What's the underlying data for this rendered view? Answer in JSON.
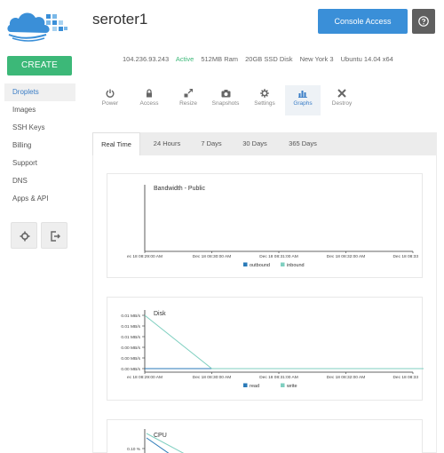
{
  "droplet": {
    "name": "seroter1",
    "ip": "104.236.93.243",
    "status": "Active",
    "ram": "512MB Ram",
    "disk": "20GB SSD Disk",
    "region": "New York 3",
    "os": "Ubuntu 14.04 x64"
  },
  "header": {
    "console_label": "Console Access"
  },
  "sidebar": {
    "create_label": "CREATE",
    "items": [
      {
        "label": "Droplets"
      },
      {
        "label": "Images"
      },
      {
        "label": "SSH Keys"
      },
      {
        "label": "Billing"
      },
      {
        "label": "Support"
      },
      {
        "label": "DNS"
      },
      {
        "label": "Apps & API"
      }
    ]
  },
  "tools": [
    {
      "label": "Power",
      "icon": "power-icon"
    },
    {
      "label": "Access",
      "icon": "lock-icon"
    },
    {
      "label": "Resize",
      "icon": "resize-icon"
    },
    {
      "label": "Snapshots",
      "icon": "camera-icon"
    },
    {
      "label": "Settings",
      "icon": "gear-icon"
    },
    {
      "label": "Graphs",
      "icon": "bar-chart-icon"
    },
    {
      "label": "Destroy",
      "icon": "close-icon"
    }
  ],
  "ranges": [
    {
      "label": "Real Time"
    },
    {
      "label": "24 Hours"
    },
    {
      "label": "7 Days"
    },
    {
      "label": "30 Days"
    },
    {
      "label": "365 Days"
    }
  ],
  "colors": {
    "accent": "#3a8fd8",
    "create": "#3cb878",
    "outbound": "#2a7ab8",
    "inbound": "#7fcfc0"
  },
  "chart_data": [
    {
      "type": "line",
      "title": "Bandwidth - Public",
      "x_ticks": [
        "ec 18 08:29:00 AM",
        "Dec 18 08:30:00 AM",
        "Dec 18 08:31:00 AM",
        "Dec 18 08:32:00 AM",
        "Dec 18 08:33"
      ],
      "series": [
        {
          "name": "outbound",
          "values": []
        },
        {
          "name": "inbound",
          "values": []
        }
      ]
    },
    {
      "type": "line",
      "title": "Disk",
      "y_ticks": [
        "0.01 MB/s",
        "0.01 MB/s",
        "0.01 MB/s",
        "0.00 MB/s",
        "0.00 MB/s",
        "0.00 MB/s"
      ],
      "x_ticks": [
        "ec 18 08:29:00 AM",
        "Dec 18 08:30:00 AM",
        "Dec 18 08:31:00 AM",
        "Dec 18 08:32:00 AM",
        "Dec 18 08:33"
      ],
      "series": [
        {
          "name": "read",
          "x": [
            0,
            4.4
          ],
          "values": [
            0.0,
            0.0
          ]
        },
        {
          "name": "write",
          "x": [
            0,
            1,
            4.4
          ],
          "values": [
            0.01,
            0.0,
            0.0
          ]
        }
      ]
    },
    {
      "type": "line",
      "title": "CPU",
      "y_ticks": [
        "0.10 %"
      ],
      "series": []
    }
  ]
}
